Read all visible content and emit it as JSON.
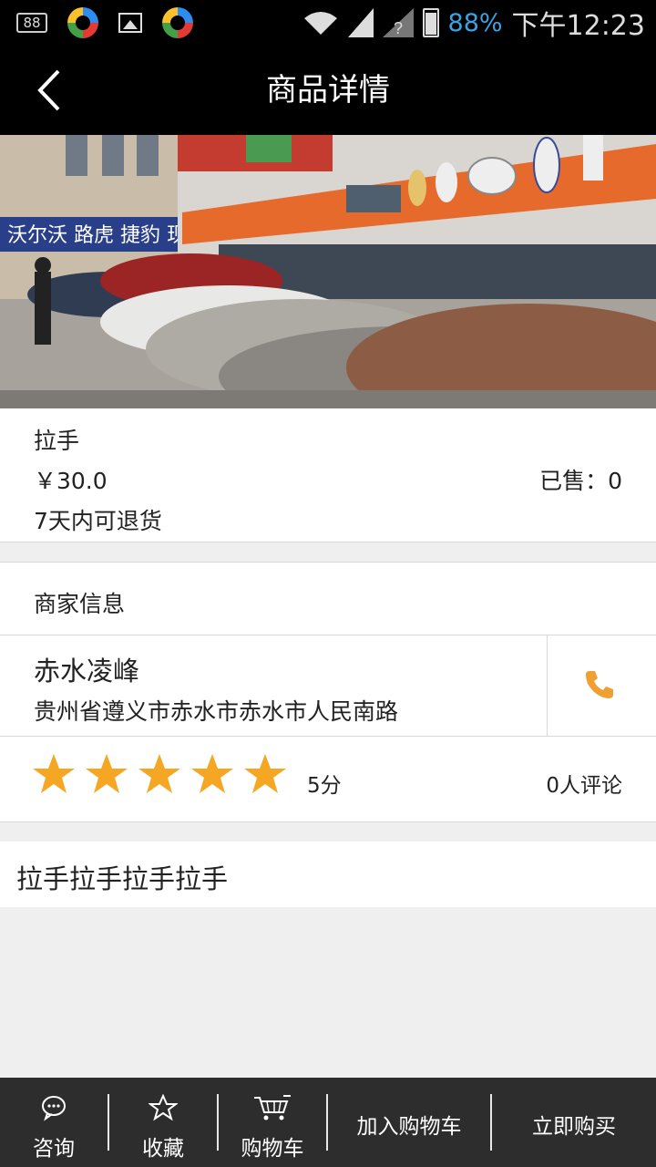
{
  "status_bar": {
    "notification_count": "88",
    "battery_percent": "88%",
    "time": "下午12:23"
  },
  "header": {
    "title": "商品详情",
    "back_icon": "back-arrow-icon"
  },
  "hero": {
    "storefront_signs": [
      "沃尔沃 路虎 捷豹 现"
    ]
  },
  "product": {
    "name": "拉手",
    "price": "￥30.0",
    "sold": "已售：0",
    "return_policy": "7天内可退货"
  },
  "merchant": {
    "section_label": "商家信息",
    "name": "赤水凌峰",
    "address": "贵州省遵义市赤水市赤水市人民南路",
    "phone_icon": "phone-icon"
  },
  "rating": {
    "stars": 5,
    "score": "5分",
    "reviews": "0人评论"
  },
  "description": {
    "text": "拉手拉手拉手拉手"
  },
  "bottom_bar": {
    "consult": "咨询",
    "favorite": "收藏",
    "cart": "购物车",
    "add_to_cart": "加入购物车",
    "buy_now": "立即购买"
  },
  "colors": {
    "accent_star": "#f5a623",
    "phone": "#f0a030",
    "bar": "#2d2d2d"
  }
}
